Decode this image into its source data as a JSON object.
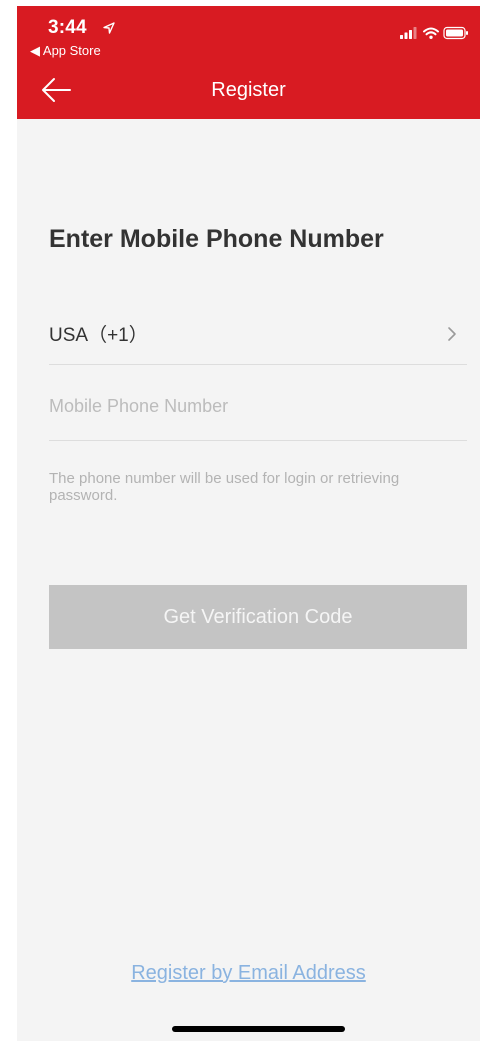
{
  "status_bar": {
    "time": "3:44",
    "back_app": "◀ App Store"
  },
  "nav": {
    "title": "Register",
    "back_icon": "back-arrow-icon"
  },
  "form": {
    "heading": "Enter Mobile Phone Number",
    "country": "USA（+1）",
    "phone_placeholder": "Mobile Phone Number",
    "phone_value": "",
    "helper_text": "The phone number will be used for login or retrieving password."
  },
  "actions": {
    "verify_label": "Get Verification Code",
    "email_link": "Register by Email Address"
  },
  "colors": {
    "header": "#d81b22",
    "button_disabled": "#c4c4c4",
    "link": "#8ab3e0",
    "background": "#f4f4f4"
  }
}
